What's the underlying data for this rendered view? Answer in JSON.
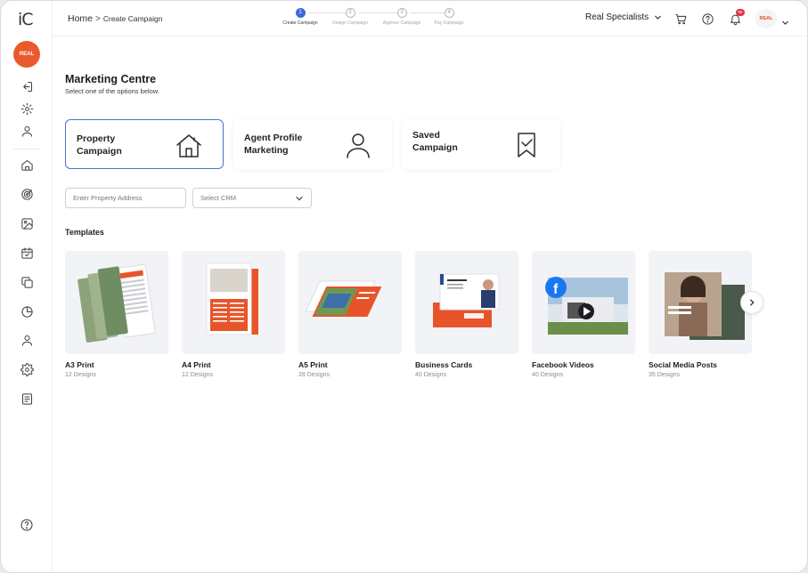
{
  "app": {
    "logo": "iC",
    "brand_badge": "REAL"
  },
  "sidebar": {
    "items": [
      {
        "name": "logout-icon"
      },
      {
        "name": "settings-icon"
      },
      {
        "name": "user-icon"
      },
      {
        "name": "home-icon"
      },
      {
        "name": "target-icon"
      },
      {
        "name": "image-icon"
      },
      {
        "name": "calendar-icon"
      },
      {
        "name": "copy-icon"
      },
      {
        "name": "pie-chart-icon"
      },
      {
        "name": "profile-icon"
      },
      {
        "name": "gear-icon"
      },
      {
        "name": "document-icon"
      }
    ],
    "help": "help-icon"
  },
  "header": {
    "breadcrumb": {
      "home": "Home",
      "separator": ">",
      "current": "Create Campaign"
    },
    "steps": [
      {
        "num": "1",
        "label": "Create Campaign",
        "active": true
      },
      {
        "num": "2",
        "label": "Design Campaign",
        "active": false
      },
      {
        "num": "3",
        "label": "Approve Campaign",
        "active": false
      },
      {
        "num": "4",
        "label": "Pay Campaign",
        "active": false
      }
    ],
    "org": "Real Specialists",
    "notification_count": "99",
    "user_badge": "REAL"
  },
  "main": {
    "title": "Marketing Centre",
    "subtitle": "Select one of the options below.",
    "campaign_types": [
      {
        "label": "Property\nCampaign",
        "icon": "house-icon",
        "active": true
      },
      {
        "label": "Agent Profile\nMarketing",
        "icon": "person-icon",
        "active": false
      },
      {
        "label": "Saved\nCampaign",
        "icon": "bookmark-check-icon",
        "active": false
      }
    ],
    "address_placeholder": "Enter Property Address",
    "crm_select": "Select CRM",
    "templates_title": "Templates",
    "templates": [
      {
        "name": "A3 Print",
        "count": "12 Designs"
      },
      {
        "name": "A4 Print",
        "count": "12 Designs"
      },
      {
        "name": "A5 Print",
        "count": "28 Designs"
      },
      {
        "name": "Business Cards",
        "count": "40 Designs"
      },
      {
        "name": "Facebook Videos",
        "count": "40 Designs"
      },
      {
        "name": "Social Media Posts",
        "count": "35 Designs"
      }
    ]
  },
  "colors": {
    "accent": "#3f6ad8",
    "brand": "#ea5a2c",
    "card_border": "#4a74c9"
  }
}
